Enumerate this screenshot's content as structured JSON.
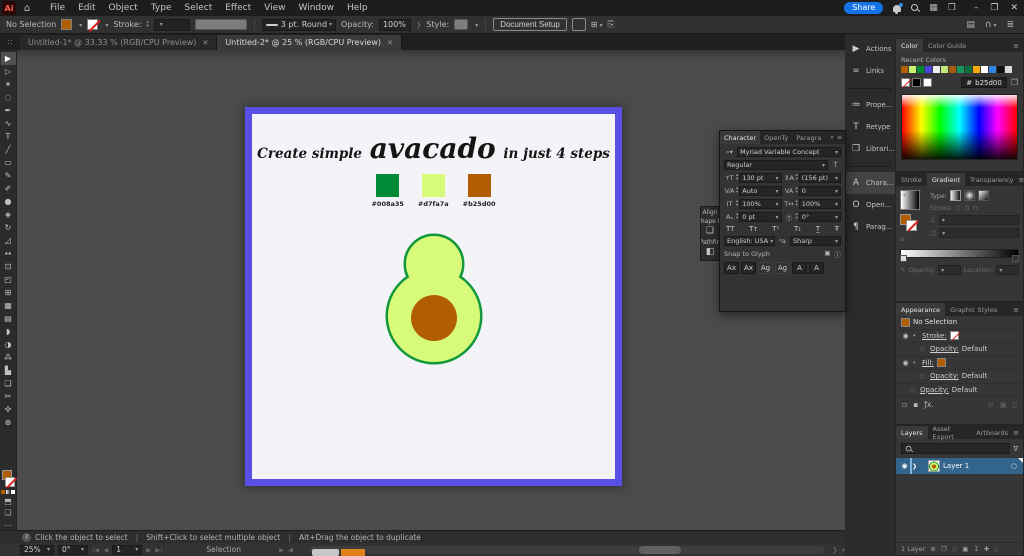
{
  "app": {
    "logo": "Ai",
    "fill_hex": "#b25d00",
    "accent_blue": "#1473e6",
    "menus": [
      "File",
      "Edit",
      "Object",
      "Type",
      "Select",
      "Effect",
      "View",
      "Window",
      "Help"
    ],
    "share": "Share"
  },
  "options": {
    "no_selection": "No Selection",
    "stroke_label": "Stroke:",
    "brush": "3 pt. Round",
    "opacity_label": "Opacity:",
    "opacity_value": "100%",
    "style_label": "Style:",
    "doc_setup": "Document Setup",
    "preferences": "Preferences"
  },
  "doc_tabs": [
    {
      "label": "Untitled-1* @ 33.33 % (RGB/CPU Preview)",
      "active": false,
      "close": "✕"
    },
    {
      "label": "Untitled-2* @ 25 % (RGB/CPU Preview)",
      "active": true,
      "close": "✕"
    }
  ],
  "tools": [
    {
      "name": "selection-tool",
      "glyph": "▶",
      "active": true
    },
    {
      "name": "direct-selection-tool",
      "glyph": "▷",
      "active": false
    },
    {
      "name": "magic-wand-tool",
      "glyph": "✶",
      "active": false
    },
    {
      "name": "lasso-tool",
      "glyph": "◌",
      "active": false
    },
    {
      "name": "pen-tool",
      "glyph": "✒",
      "active": false
    },
    {
      "name": "curvature-tool",
      "glyph": "∿",
      "active": false
    },
    {
      "name": "type-tool",
      "glyph": "T",
      "active": false
    },
    {
      "name": "line-segment-tool",
      "glyph": "╱",
      "active": false
    },
    {
      "name": "rectangle-tool",
      "glyph": "▭",
      "active": false
    },
    {
      "name": "paintbrush-tool",
      "glyph": "✎",
      "active": false
    },
    {
      "name": "shaper-tool",
      "glyph": "✐",
      "active": false
    },
    {
      "name": "blob-brush-tool",
      "glyph": "●",
      "active": false
    },
    {
      "name": "eraser-tool",
      "glyph": "◈",
      "active": false
    },
    {
      "name": "rotate-tool",
      "glyph": "↻",
      "active": false
    },
    {
      "name": "scale-tool",
      "glyph": "◿",
      "active": false
    },
    {
      "name": "width-tool",
      "glyph": "↔",
      "active": false
    },
    {
      "name": "free-transform-tool",
      "glyph": "⊡",
      "active": false
    },
    {
      "name": "shape-builder-tool",
      "glyph": "◰",
      "active": false
    },
    {
      "name": "perspective-grid-tool",
      "glyph": "⊞",
      "active": false
    },
    {
      "name": "mesh-tool",
      "glyph": "▦",
      "active": false
    },
    {
      "name": "gradient-tool",
      "glyph": "▤",
      "active": false
    },
    {
      "name": "eyedropper-tool",
      "glyph": "◗",
      "active": false
    },
    {
      "name": "blend-tool",
      "glyph": "◑",
      "active": false
    },
    {
      "name": "symbol-sprayer-tool",
      "glyph": "⁂",
      "active": false
    },
    {
      "name": "column-graph-tool",
      "glyph": "▙",
      "active": false
    },
    {
      "name": "artboard-tool",
      "glyph": "❏",
      "active": false
    },
    {
      "name": "slice-tool",
      "glyph": "✂",
      "active": false
    },
    {
      "name": "hand-tool",
      "glyph": "✣",
      "active": false
    },
    {
      "name": "zoom-tool",
      "glyph": "⊕",
      "active": false
    }
  ],
  "artboard": {
    "frame_color": "#5a4fe4",
    "title_pre": "Create simple",
    "title_word": "avacado",
    "title_post": "in just 4 steps",
    "palette": [
      {
        "color": "#008a35",
        "label": "#008a35"
      },
      {
        "color": "#d7fa7a",
        "label": "#d7fa7a"
      },
      {
        "color": "#b25d00",
        "label": "#b25d00"
      }
    ],
    "avocado": {
      "outline": "#13993b",
      "flesh": "#d7fa7a",
      "pit": "#b25d00"
    }
  },
  "mini_dock": [
    {
      "label": "Align",
      "glyph": ""
    },
    {
      "label": "Shape M",
      "glyph": "❏"
    },
    {
      "label": "Pathfin",
      "glyph": "◧"
    }
  ],
  "character": {
    "tabs": [
      {
        "label": "Character",
        "active": true
      },
      {
        "label": "OpenTy",
        "active": false
      },
      {
        "label": "Paragra",
        "active": false
      }
    ],
    "font": "Myriad Variable Concept",
    "style": "Regular",
    "size": "130 pt",
    "leading": "(156 pt)",
    "kerning": "Auto",
    "tracking": "0",
    "vscale": "100%",
    "hscale": "100%",
    "baseline": "0 pt",
    "rotate": "0°",
    "case_buttons": [
      "TT",
      "Tᴛ",
      "T¹",
      "T₁",
      "T̲",
      "Ŧ"
    ],
    "language": "English: USA",
    "aa_label": "Sharp",
    "snap_label": "Snap to Glyph",
    "touch_buttons": [
      {
        "label": "Ax",
        "lite": false
      },
      {
        "label": "Ax",
        "lite": false
      },
      {
        "label": "Ag",
        "lite": true
      },
      {
        "label": "Ag",
        "lite": true
      },
      {
        "label": "A",
        "lite": false
      },
      {
        "label": "A",
        "lite": false
      }
    ]
  },
  "dock": [
    {
      "label": "Actions",
      "glyph": "▶",
      "active": false,
      "sep": false
    },
    {
      "label": "Links",
      "glyph": "∞",
      "active": false,
      "sep": false
    },
    {
      "label": "Prope...",
      "glyph": "≔",
      "active": false,
      "sep": true
    },
    {
      "label": "Retype",
      "glyph": "T",
      "active": false,
      "sep": false
    },
    {
      "label": "Librari...",
      "glyph": "❒",
      "active": false,
      "sep": false
    },
    {
      "label": "Chara...",
      "glyph": "A",
      "active": true,
      "sep": true
    },
    {
      "label": "Open...",
      "glyph": "O",
      "active": false,
      "sep": false
    },
    {
      "label": "Parag...",
      "glyph": "¶",
      "active": false,
      "sep": false
    }
  ],
  "color_panel": {
    "tabs": [
      {
        "label": "Color",
        "active": true
      },
      {
        "label": "Color Guide",
        "active": false
      }
    ],
    "recent_label": "Recent Colors",
    "recent": [
      "#b25d00",
      "#cdf06e",
      "#008a35",
      "#4a43dd",
      "#eceef2",
      "#c3e87c",
      "#a55a12",
      "#169658",
      "#0b6e3f",
      "#f2a60d",
      "#ffffff",
      "#2d84e2",
      "#111111",
      "#d9d9d9"
    ],
    "hex_prefix": "#",
    "hex": "b25d00"
  },
  "gradient_panel": {
    "tabs": [
      {
        "label": "Stroke",
        "active": false
      },
      {
        "label": "Gradient",
        "active": true
      },
      {
        "label": "Transparency",
        "active": false
      }
    ],
    "type_label": "Type:",
    "stroke_label": "Stroke:",
    "opacity_label": "Opacity:",
    "location_label": "Location:"
  },
  "appearance_panel": {
    "tabs": [
      {
        "label": "Appearance",
        "active": true
      },
      {
        "label": "Graphic Styles",
        "active": false
      }
    ],
    "no_selection": "No Selection",
    "stroke_label": "Stroke:",
    "fill_label": "Fill:",
    "opacity_label": "Opacity:",
    "opacity_value": "Default",
    "fx": "ƒx."
  },
  "layers_panel": {
    "tabs": [
      {
        "label": "Layers",
        "active": true
      },
      {
        "label": "Asset Export",
        "active": false
      },
      {
        "label": "Artboards",
        "active": false
      }
    ],
    "layer_name": "Layer 1",
    "count": "1 Layer"
  },
  "statusbar": {
    "hints": [
      "Click the object to select",
      "Shift+Click to select multiple object",
      "Alt+Drag the object to duplicate"
    ],
    "zoom": "25%",
    "rotation": "0°",
    "artboard_num": "1",
    "tool": "Selection"
  }
}
